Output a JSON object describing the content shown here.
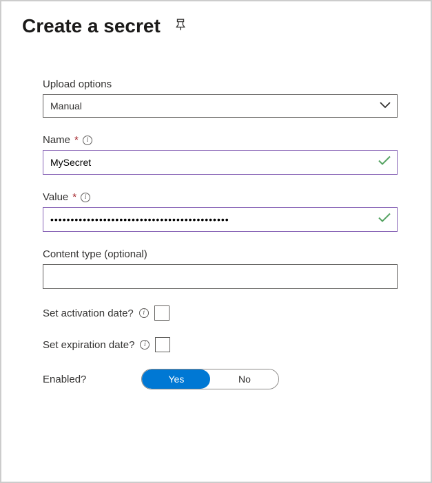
{
  "header": {
    "title": "Create a secret"
  },
  "form": {
    "upload_options": {
      "label": "Upload options",
      "value": "Manual"
    },
    "name": {
      "label": "Name",
      "value": "MySecret",
      "required": "*"
    },
    "value": {
      "label": "Value",
      "value": "••••••••••••••••••••••••••••••••••••••••••••",
      "required": "*"
    },
    "content_type": {
      "label": "Content type (optional)",
      "value": ""
    },
    "activation": {
      "label": "Set activation date?"
    },
    "expiration": {
      "label": "Set expiration date?"
    },
    "enabled": {
      "label": "Enabled?",
      "yes": "Yes",
      "no": "No"
    }
  }
}
